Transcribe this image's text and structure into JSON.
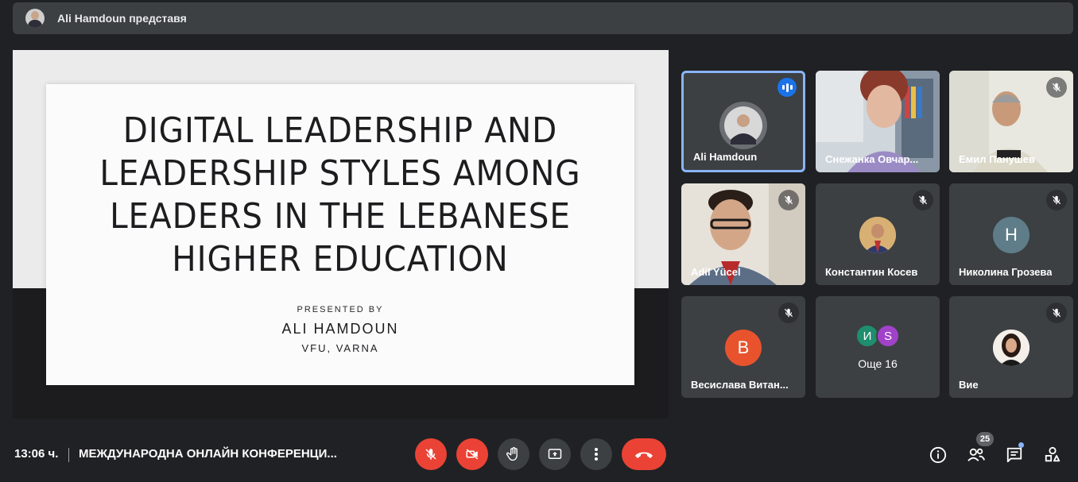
{
  "presenter": {
    "label": "Ali Hamdoun представя"
  },
  "slide": {
    "title": "DIGITAL LEADERSHIP AND LEADERSHIP STYLES AMONG LEADERS IN THE LEBANESE HIGHER EDUCATION",
    "presented_by": "PRESENTED BY",
    "author": "ALI HAMDOUN",
    "affiliation": "VFU, VARNA"
  },
  "participants": [
    {
      "name": "Ali Hamdoun",
      "status": "speaking"
    },
    {
      "name": "Снежанка Овчар...",
      "status": "video"
    },
    {
      "name": "Емил Панушев",
      "status": "muted"
    },
    {
      "name": "Adil Yücel",
      "status": "muted"
    },
    {
      "name": "Константин Косев",
      "status": "muted"
    },
    {
      "name": "Николина Грозева",
      "status": "muted",
      "initial": "Н"
    },
    {
      "name": "Весислава Витан...",
      "status": "muted",
      "initial": "В"
    },
    {
      "name": "Вие",
      "status": "muted"
    }
  ],
  "more": {
    "initials": [
      "И",
      "S"
    ],
    "label": "Още 16"
  },
  "bottom": {
    "time": "13:06 ч.",
    "meeting_title": "МЕЖДУНАРОДНА ОНЛАЙН КОНФЕРЕНЦИ...",
    "people_count": "25"
  },
  "colors": {
    "accent": "#8ab4f8",
    "end_call": "#ea4335",
    "tile": "#3c4043",
    "background": "#202124"
  }
}
